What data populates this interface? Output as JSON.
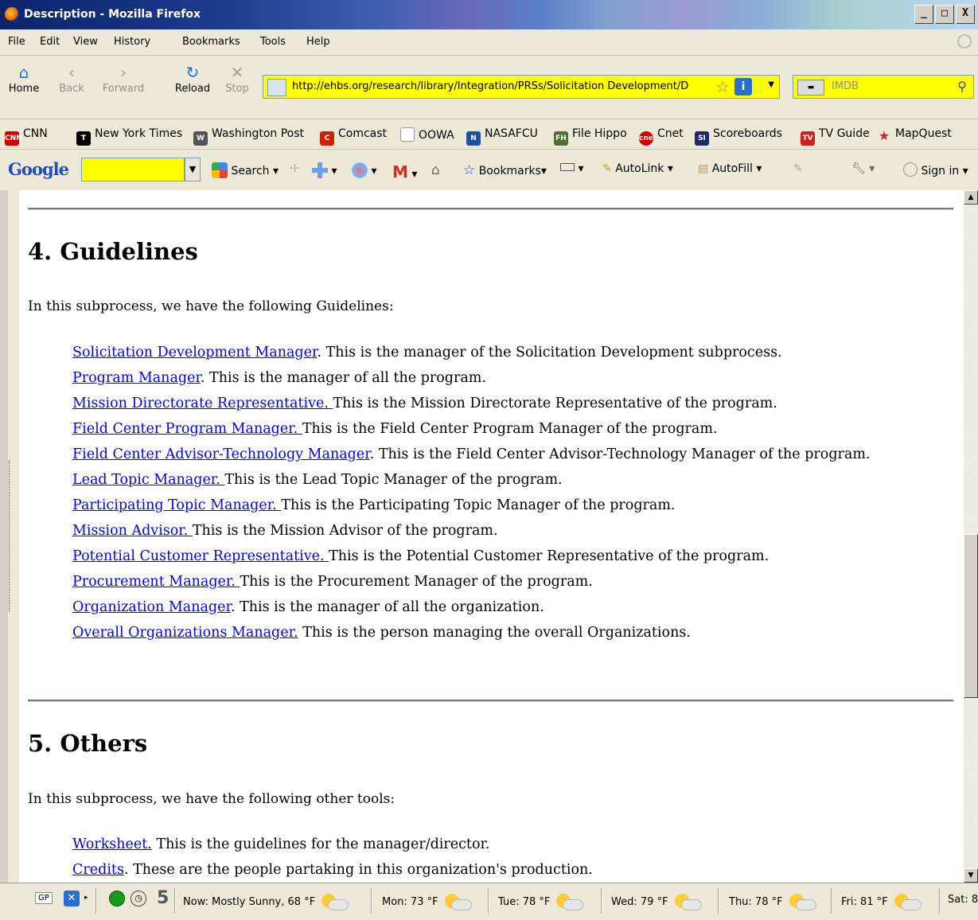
{
  "window": {
    "title": "Description - Mozilla Firefox",
    "buttons": [
      "_",
      "□",
      "X"
    ]
  },
  "menu": [
    "File",
    "Edit",
    "View",
    "History",
    "Bookmarks",
    "Tools",
    "Help"
  ],
  "nav": {
    "home": "Home",
    "back": "Back",
    "forward": "Forward",
    "reload": "Reload",
    "stop": "Stop",
    "url": "http://ehbs.org/research/library/Integration/PRSs/Solicitation Development/D",
    "search_placeholder": "IMDB"
  },
  "bookmarks": [
    {
      "label": "CNN",
      "icon": "cnn-icon",
      "badge": "CNN",
      "color": "#cc0000"
    },
    {
      "label": "New York Times",
      "icon": "nyt-icon",
      "badge": "T",
      "color": "#000000"
    },
    {
      "label": "Washington Post",
      "icon": "wapo-icon",
      "badge": "W",
      "color": "#555555"
    },
    {
      "label": "Comcast",
      "icon": "comcast-icon",
      "badge": "C",
      "color": "#cc2200"
    },
    {
      "label": "OOWA",
      "icon": "page-icon",
      "badge": "",
      "color": "#ffffff"
    },
    {
      "label": "NASAFCU",
      "icon": "nasafcu-icon",
      "badge": "N",
      "color": "#2050a0"
    },
    {
      "label": "File Hippo",
      "icon": "filehippo-icon",
      "badge": "FH",
      "color": "#507030"
    },
    {
      "label": "Cnet",
      "icon": "cnet-icon",
      "badge": "cnet",
      "color": "#cc0000"
    },
    {
      "label": "Scoreboards",
      "icon": "si-icon",
      "badge": "SI",
      "color": "#1a2a6a"
    },
    {
      "label": "TV Guide",
      "icon": "tvguide-icon",
      "badge": "TV",
      "color": "#cc2020"
    },
    {
      "label": "MapQuest",
      "icon": "mapquest-icon",
      "badge": "★",
      "color": "#dd2222"
    }
  ],
  "google_toolbar": {
    "logo": "Google",
    "search": "Search",
    "bookmarks": "Bookmarks",
    "autolink": "AutoLink",
    "autofill": "AutoFill",
    "signin": "Sign in"
  },
  "content": {
    "section4": {
      "title": "4. Guidelines",
      "intro": "In this subprocess, we have the following Guidelines:",
      "items": [
        {
          "link": "Solicitation Development Manager",
          "desc": ". This is the manager of the Solicitation Development subprocess."
        },
        {
          "link": "Program Manager",
          "desc": ". This is the manager of all the program."
        },
        {
          "link": "Mission Directorate Representative. ",
          "desc": "This is the Mission Directorate Representative of the program."
        },
        {
          "link": "Field Center Program Manager. ",
          "desc": "This is the Field Center Program Manager of the program."
        },
        {
          "link": "Field Center Advisor-Technology Manager",
          "desc": ". This is the Field Center Advisor-Technology Manager of the program."
        },
        {
          "link": "Lead Topic Manager. ",
          "desc": "This is the Lead Topic Manager of the program."
        },
        {
          "link": "Participating Topic Manager. ",
          "desc": "This is the Participating Topic Manager of the program."
        },
        {
          "link": "Mission Advisor. ",
          "desc": "This is the Mission Advisor of the program."
        },
        {
          "link": "Potential Customer Representative. ",
          "desc": "This is the Potential Customer Representative of the program."
        },
        {
          "link": "Procurement Manager. ",
          "desc": "This is the Procurement Manager of the program."
        },
        {
          "link": "Organization Manager",
          "desc": ". This is the manager of all the organization."
        },
        {
          "link": "Overall Organizations Manager.",
          "desc": " This is the person managing the overall Organizations."
        }
      ]
    },
    "section5": {
      "title": "5. Others",
      "intro": "In this subprocess, we have the following other tools:",
      "items": [
        {
          "link": "Worksheet.",
          "desc": " This is the guidelines for the manager/director."
        },
        {
          "link": "Credits",
          "desc": ". These are the people partaking in this organization's production."
        }
      ]
    }
  },
  "status": {
    "gp": "GP",
    "count": "5",
    "weather": [
      {
        "text": "Now: Mostly Sunny, 68 °F"
      },
      {
        "text": "Mon: 73 °F"
      },
      {
        "text": "Tue: 78 °F"
      },
      {
        "text": "Wed: 79 °F"
      },
      {
        "text": "Thu: 78 °F"
      },
      {
        "text": "Fri: 81 °F"
      },
      {
        "text": "Sat: 8"
      }
    ]
  },
  "colors": {
    "link": "#0000ee",
    "highlight": "#ffff00"
  }
}
